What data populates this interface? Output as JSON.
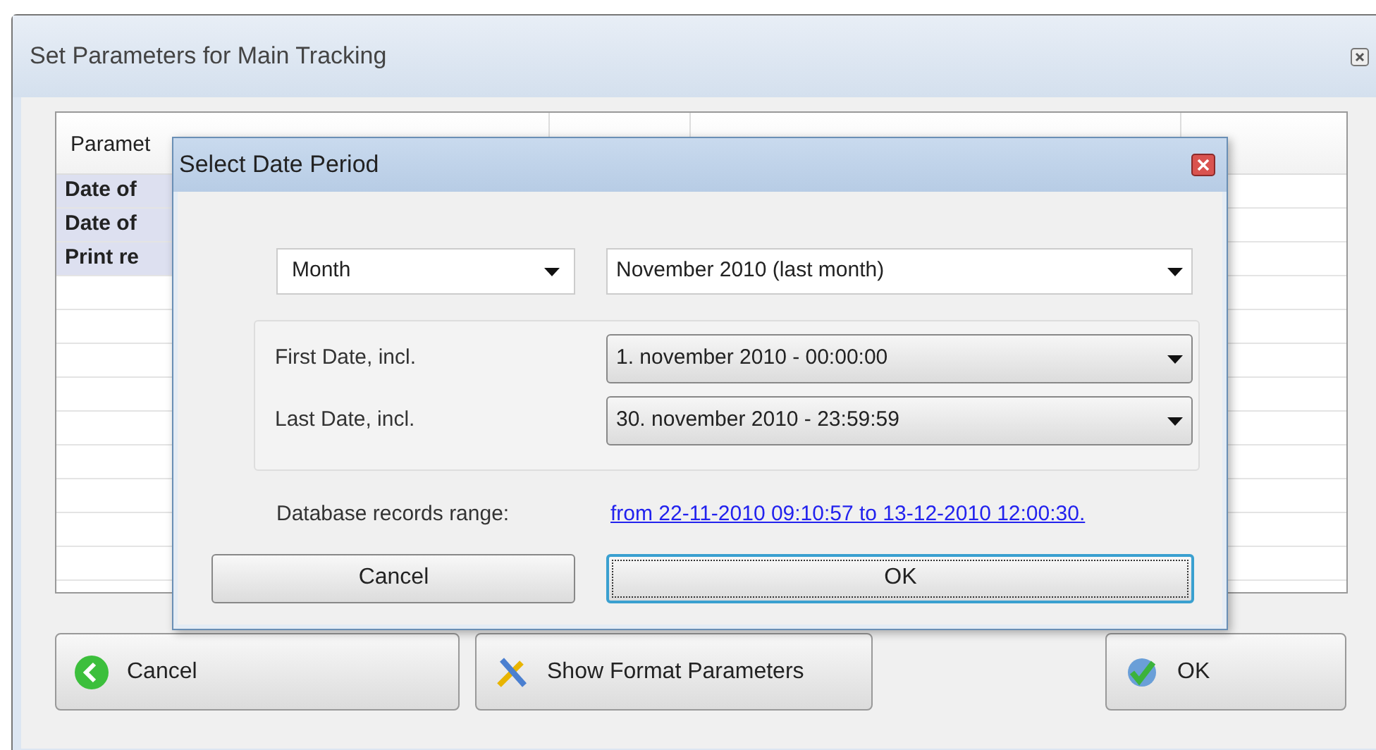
{
  "window": {
    "title": "Set Parameters for Main Tracking"
  },
  "table": {
    "columns": [
      "Paramet"
    ],
    "rows": [
      {
        "name": "Date of"
      },
      {
        "name": "Date of"
      },
      {
        "name": "Print re"
      }
    ]
  },
  "buttons": [
    {
      "kind": "cancel",
      "label": "Cancel"
    },
    {
      "kind": "format",
      "label": "Show Format Parameters"
    },
    {
      "kind": "ok",
      "label": "OK"
    }
  ],
  "dialog": {
    "title": "Select Date Period",
    "period_type": "Month",
    "period": "November 2010 (last month)",
    "dates": [
      {
        "label": "First Date, incl.",
        "value": "1. november 2010 - 00:00:00"
      },
      {
        "label": "Last Date, incl.",
        "value": "30. november 2010 - 23:59:59"
      }
    ],
    "range_label": "Database records range:",
    "range_link": "from 22-11-2010 09:10:57 to 13-12-2010 12:00:30.",
    "buttons": [
      {
        "label": "Cancel",
        "focused": false
      },
      {
        "label": "OK",
        "focused": true
      }
    ]
  }
}
